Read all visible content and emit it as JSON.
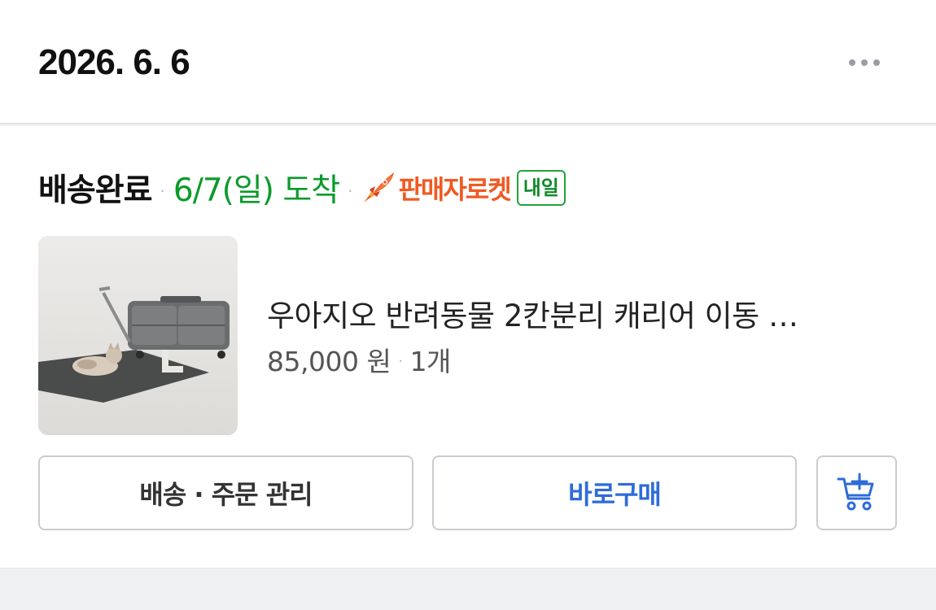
{
  "header": {
    "date": "2026. 6. 6",
    "more_icon": "more-horizontal-icon"
  },
  "order": {
    "status": "배송완료",
    "arrival": "6/7(일) 도착",
    "separator": "·",
    "rocket_label": "판매자로켓",
    "rocket_icon": "rocket-icon",
    "tomorrow_tag": "내일",
    "colors": {
      "arrival": "#0a9b2b",
      "rocket": "#f05a23",
      "tag": "#21a33b",
      "buy_button": "#2e6bd9"
    }
  },
  "product": {
    "name": "우아지오 반려동물 2칸분리 캐리어 이동 …",
    "price": "85,000 원",
    "quantity": "1개",
    "image_alt": "pet-carrier-with-cat-photo"
  },
  "actions": {
    "manage_label": "배송 · 주문 관리",
    "buy_label": "바로구매",
    "cart_icon": "add-to-cart-icon"
  }
}
